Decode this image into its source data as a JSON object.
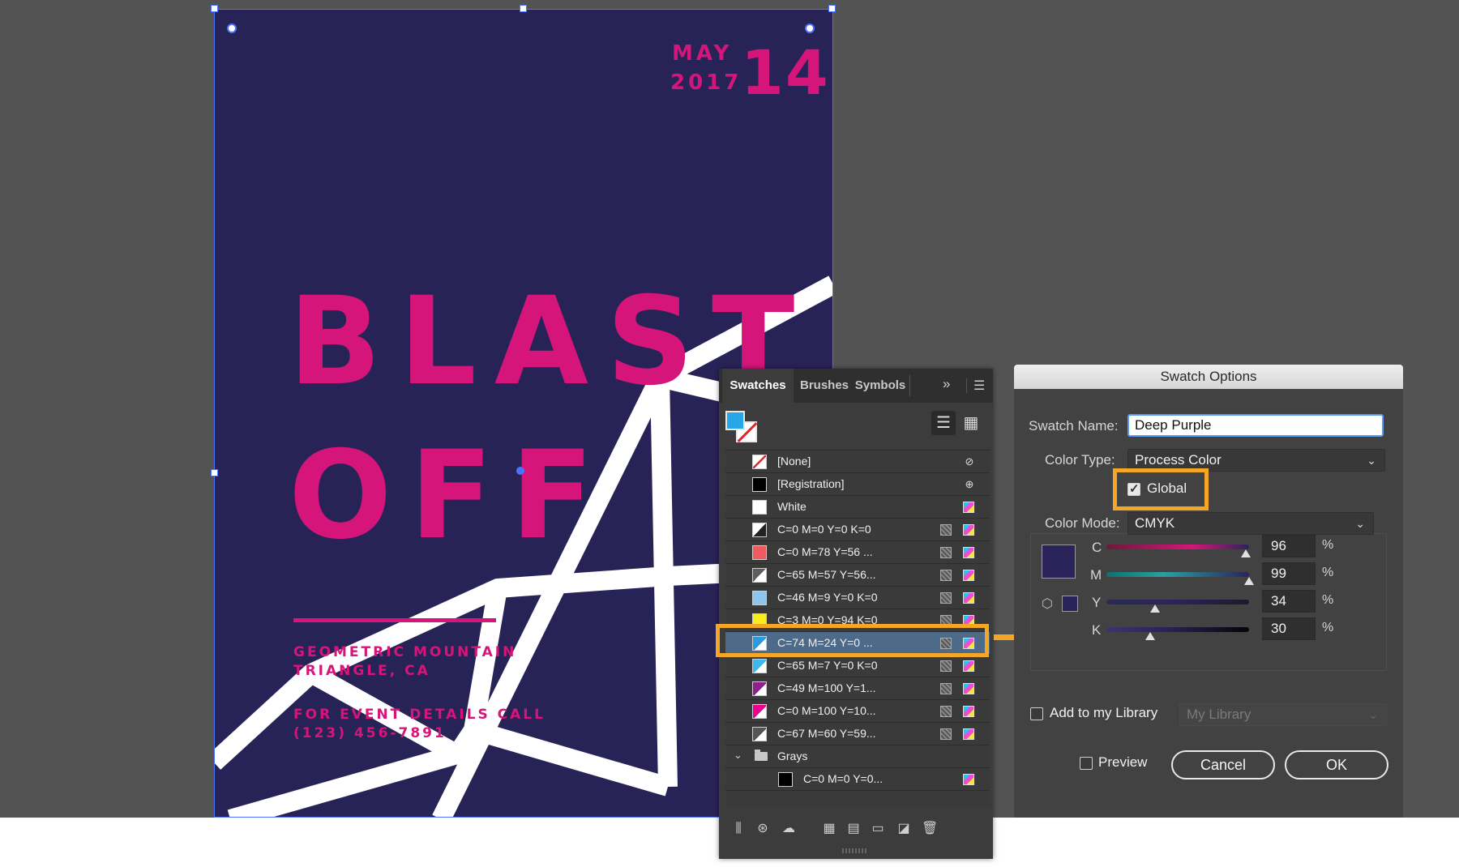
{
  "poster": {
    "month": "MAY",
    "year": "2017",
    "day": "14",
    "headline_1": "BLAST",
    "headline_2": "OFF",
    "location_1": "GEOMETRIC MOUNTAIN",
    "location_2": "TRIANGLE, CA",
    "contact_1": "FOR EVENT DETAILS CALL",
    "contact_2": "(123) 456-7891",
    "colors": {
      "background": "#282357",
      "accent": "#d6157a",
      "shape": "#ffffff"
    }
  },
  "swatches_panel": {
    "tabs": [
      "Swatches",
      "Brushes",
      "Symbols"
    ],
    "active_tab": "Swatches",
    "fill_color": "#27a7e7",
    "items": [
      {
        "label": "[None]",
        "chip": "none"
      },
      {
        "label": "[Registration]",
        "chip": "#000000"
      },
      {
        "label": "White",
        "chip": "#ffffff"
      },
      {
        "label": "C=0 M=0 Y=0 K=0",
        "chip": "#ffffff"
      },
      {
        "label": "C=0 M=78 Y=56 ...",
        "chip": "#ee5a5e"
      },
      {
        "label": "C=65 M=57 Y=56...",
        "chip": "#5e5e5e"
      },
      {
        "label": "C=46 M=9 Y=0 K=0",
        "chip": "#8ac6ee"
      },
      {
        "label": "C=3 M=0 Y=94 K=0",
        "chip": "#f9ee1a"
      },
      {
        "label": "C=74 M=24 Y=0 ...",
        "chip": "#2b9be0",
        "selected": true
      },
      {
        "label": "C=65 M=7 Y=0 K=0",
        "chip": "#3bb9ee"
      },
      {
        "label": "C=49 M=100 Y=1...",
        "chip": "#8e1f8c"
      },
      {
        "label": "C=0 M=100 Y=10...",
        "chip": "#ec008c"
      },
      {
        "label": "C=67 M=60 Y=59...",
        "chip": "#555555"
      }
    ],
    "group": {
      "label": "Grays",
      "items": [
        {
          "label": "C=0 M=0 Y=0...",
          "chip": "#000000"
        }
      ]
    }
  },
  "dialog": {
    "title": "Swatch Options",
    "swatch_name_label": "Swatch Name:",
    "swatch_name": "Deep Purple",
    "color_type_label": "Color Type:",
    "color_type": "Process Color",
    "global_label": "Global",
    "global_checked": true,
    "color_mode_label": "Color Mode:",
    "color_mode": "CMYK",
    "channels": [
      {
        "name": "C",
        "value": "96"
      },
      {
        "name": "M",
        "value": "99"
      },
      {
        "name": "Y",
        "value": "34"
      },
      {
        "name": "K",
        "value": "30"
      }
    ],
    "percent": "%",
    "add_library_label": "Add to my Library",
    "library_value": "My Library",
    "preview_label": "Preview",
    "cancel_label": "Cancel",
    "ok_label": "OK",
    "swatch_color": "#2b245a"
  },
  "highlight_color": "#f4a626"
}
